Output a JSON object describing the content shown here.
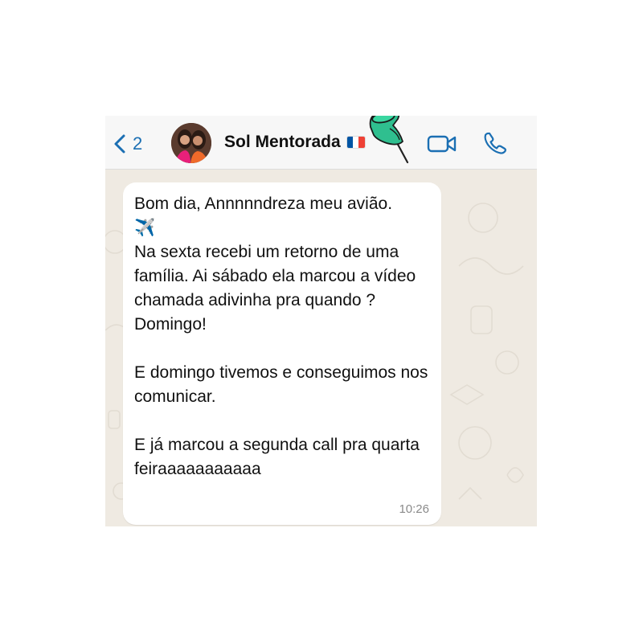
{
  "header": {
    "back_count": "2",
    "contact_name": "Sol Mentorada",
    "flag_colors": [
      "#0055a4",
      "#ffffff",
      "#ef4135"
    ],
    "icons": [
      "chevron-left-icon",
      "pin-icon",
      "video-camera-icon",
      "phone-icon"
    ],
    "accent_color": "#1b6fb3"
  },
  "message": {
    "text": "Bom dia, Annnnndreza meu avião.\n✈️\nNa sexta recebi um retorno de uma família. Ai sábado ela marcou a vídeo chamada adivinha pra quando ? Domingo!\n\nE domingo tivemos e conseguimos nos comunicar.\n\nE já marcou a segunda call pra quarta feiraaaaaaaaaaa",
    "time": "10:26"
  }
}
